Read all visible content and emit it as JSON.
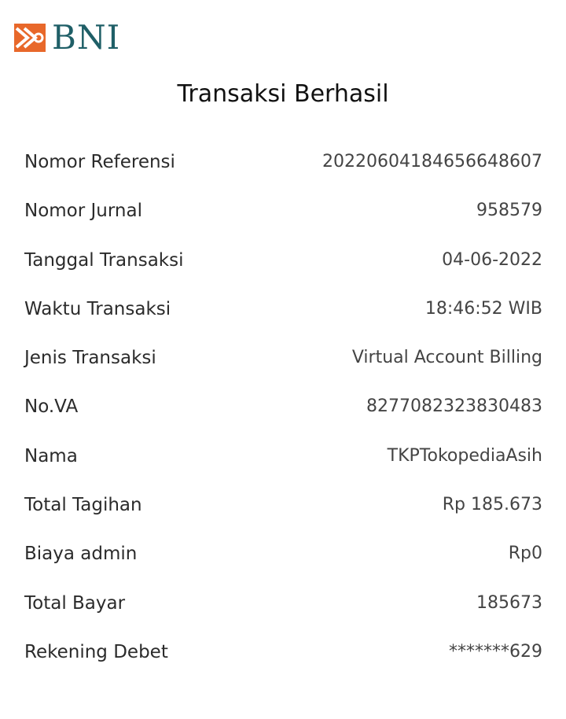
{
  "logo": {
    "text": "BNI",
    "icon": "bni-emblem-icon",
    "colors": {
      "emblem": "#e8682a",
      "text": "#1f5f67"
    }
  },
  "title": "Transaksi Berhasil",
  "details": [
    {
      "label": "Nomor Referensi",
      "value": "20220604184656648607"
    },
    {
      "label": "Nomor Jurnal",
      "value": "958579"
    },
    {
      "label": "Tanggal Transaksi",
      "value": "04-06-2022"
    },
    {
      "label": "Waktu Transaksi",
      "value": "18:46:52 WIB"
    },
    {
      "label": "Jenis Transaksi",
      "value": "Virtual Account Billing"
    },
    {
      "label": "No.VA",
      "value": "8277082323830483"
    },
    {
      "label": "Nama",
      "value": "TKPTokopediaAsih"
    },
    {
      "label": "Total Tagihan",
      "value": "Rp 185.673"
    },
    {
      "label": "Biaya admin",
      "value": "Rp0"
    },
    {
      "label": "Total Bayar",
      "value": "185673"
    },
    {
      "label": "Rekening Debet",
      "value": "*******629"
    }
  ]
}
